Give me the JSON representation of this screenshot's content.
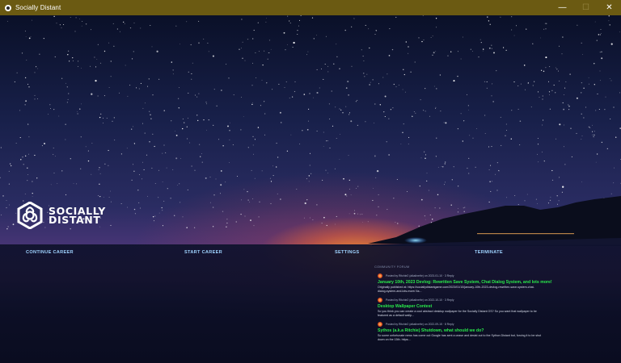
{
  "window": {
    "title": "Socially Distant",
    "controls": {
      "minimize": "—",
      "maximize": "☐",
      "close": "✕"
    },
    "titlebar_color": "#6b5a12"
  },
  "logo": {
    "line1": "SOCIALLY",
    "line2": "DISTANT"
  },
  "menu": {
    "continue_career": "CONTINUE CAREER",
    "start_career": "START CAREER",
    "settings": "SETTINGS",
    "terminate": "TERMINATE"
  },
  "forum": {
    "heading": "COMMUNITY FORUM",
    "posts": [
      {
        "meta": "Posted by Ritchie2 (alkalinethr) on 2023-01-10 · 3 Reply",
        "title": "January 10th, 2023 Devlog: Rewritten Save System, Chat Dialog System, and lots more!",
        "body1": "Originally published at: https://sociallydistantgame.com/2023/01/10/january-10th-2023-devlog-rewritten-save-system-chat-",
        "body2": "dialog-system-and-lots-more/ As..."
      },
      {
        "meta": "Posted by Ritchie2 (alkalinethr) on 2022-10-10 · 3 Reply",
        "title": "Desktop Wallpaper Contest",
        "body1": "So you think you can create a cool abstract desktop wallpaper for the Socially Distant OS? So you want that wallpaper to be",
        "body2": "featured as a default wallp..."
      },
      {
        "meta": "Posted by Ritchie2 (alkalinethr) on 2022-09-15 · 8 Reply",
        "title": "Sythos (a.k.a Ritchie) Shutdown, what should we do?",
        "body1": "So some unfortunate news has come out    Google has sent a cease and desist out to the Sython Distant bot, forcing it to be shut",
        "body2": "down on the 15th. https:..."
      }
    ]
  },
  "colors": {
    "menu_text": "#9fd3ff",
    "post_title": "#29e84a"
  }
}
